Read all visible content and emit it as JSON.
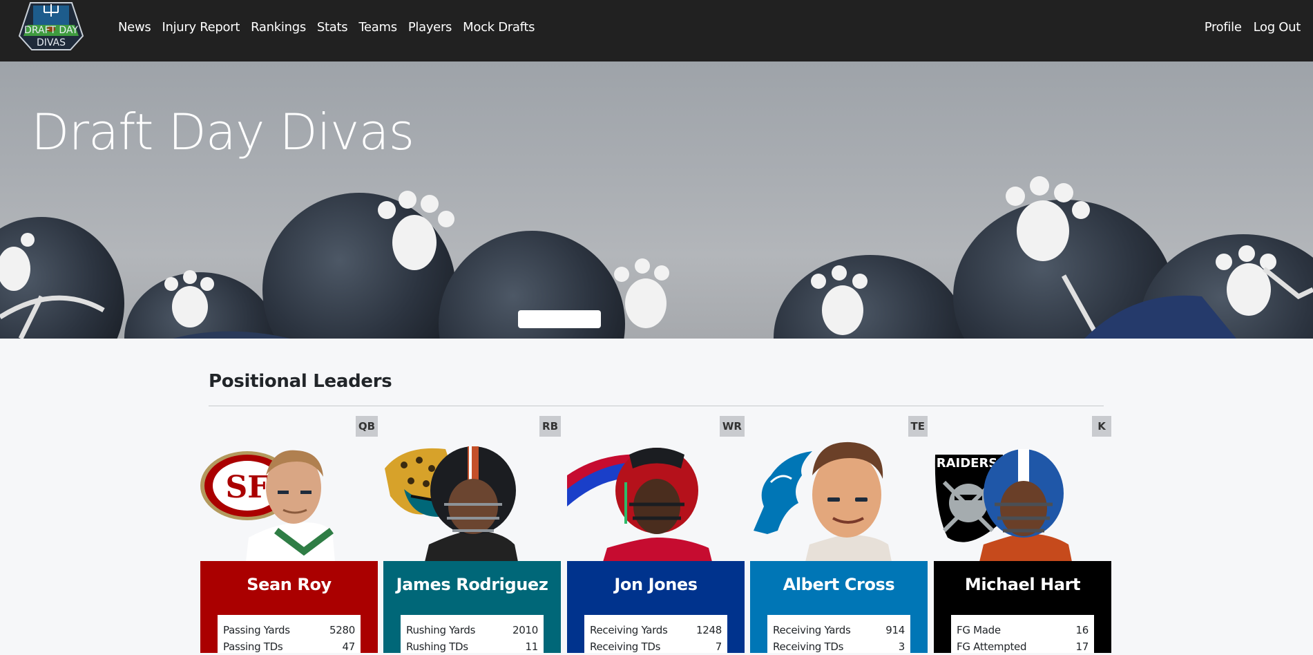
{
  "nav": {
    "logo_text_top": "DRAFT DAY",
    "logo_text_bottom": "DIVAS",
    "links": [
      "News",
      "Injury Report",
      "Rankings",
      "Stats",
      "Teams",
      "Players",
      "Mock Drafts"
    ],
    "right_links": [
      "Profile",
      "Log Out"
    ]
  },
  "hero": {
    "title": "Draft Day Divas"
  },
  "section": {
    "title": "Positional Leaders"
  },
  "cards": [
    {
      "position": "QB",
      "name": "Sean Roy",
      "team_color": "#aa0000",
      "team_logo": "49ers-logo",
      "stats": [
        {
          "label": "Passing Yards",
          "value": "5280"
        },
        {
          "label": "Passing TDs",
          "value": "47"
        }
      ]
    },
    {
      "position": "RB",
      "name": "James Rodriguez",
      "team_color": "#006778",
      "team_logo": "jaguars-logo",
      "stats": [
        {
          "label": "Rushing Yards",
          "value": "2010"
        },
        {
          "label": "Rushing TDs",
          "value": "11"
        }
      ]
    },
    {
      "position": "WR",
      "name": "Jon Jones",
      "team_color": "#00338d",
      "team_logo": "bills-logo",
      "stats": [
        {
          "label": "Receiving Yards",
          "value": "1248"
        },
        {
          "label": "Receiving TDs",
          "value": "7"
        }
      ]
    },
    {
      "position": "TE",
      "name": "Albert Cross",
      "team_color": "#0076b6",
      "team_logo": "lions-logo",
      "stats": [
        {
          "label": "Receiving Yards",
          "value": "914"
        },
        {
          "label": "Receiving TDs",
          "value": "3"
        }
      ]
    },
    {
      "position": "K",
      "name": "Michael Hart",
      "team_color": "#000000",
      "team_logo": "raiders-logo",
      "logo_text": "RAIDERS",
      "stats": [
        {
          "label": "FG Made",
          "value": "16"
        },
        {
          "label": "FG Attempted",
          "value": "17"
        }
      ]
    }
  ]
}
